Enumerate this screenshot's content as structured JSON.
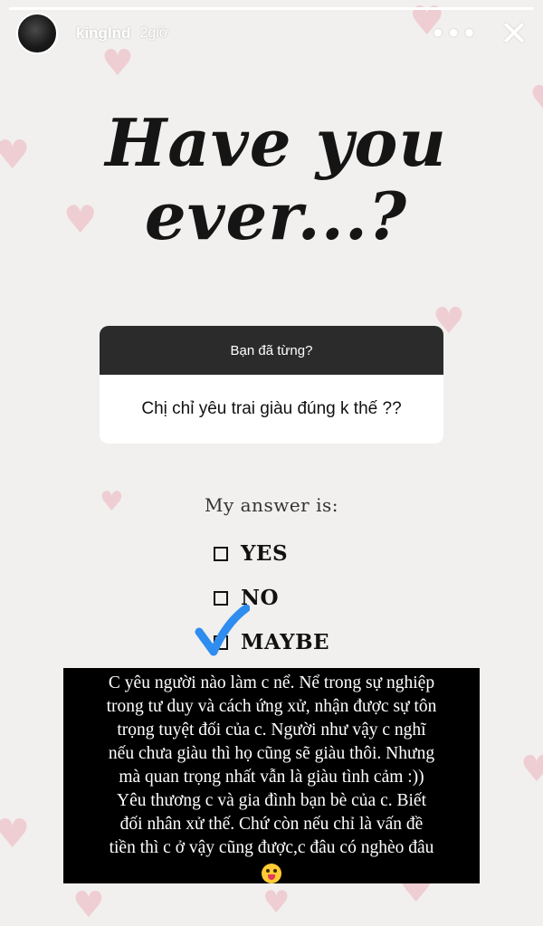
{
  "header": {
    "username": "kinglnd",
    "timestamp": "2giờ"
  },
  "icons": {
    "more": "more-options-icon",
    "close": "close-icon",
    "heart": "heart-icon",
    "checkmark": "checkmark-icon",
    "emoji": "winking-face-tongue-emoji"
  },
  "colors": {
    "background": "#f1f0ee",
    "heart": "#efc9cf",
    "check": "#2f8df0",
    "question_header": "#2b2b2b"
  },
  "story": {
    "title_line1": "Have you",
    "title_line2": "ever...?"
  },
  "question": {
    "header": "Bạn đã từng?",
    "text": "Chị chỉ yêu trai giàu đúng k thế ??"
  },
  "answer": {
    "label": "My answer is:",
    "options": [
      "YES",
      "NO",
      "MAYBE"
    ],
    "selected": "MAYBE"
  },
  "reply": {
    "text": "C yêu người nào làm c nể. Nể trong sự nghiệp\ntrong tư duy và cách ứng xử, nhận được sự tôn\ntrọng tuyệt đối của c. Người như vậy c nghĩ\nnếu chưa giàu thì họ cũng sẽ giàu thôi. Nhưng\nmà quan trọng nhất vẫn là giàu tình cảm :))\nYêu thương c và gia đình bạn bè của c. Biết\nđối nhân xử thế. Chứ còn nếu chỉ là vấn đề\ntiền thì c ở vậy cũng được,c đâu có nghèo đâu"
  }
}
